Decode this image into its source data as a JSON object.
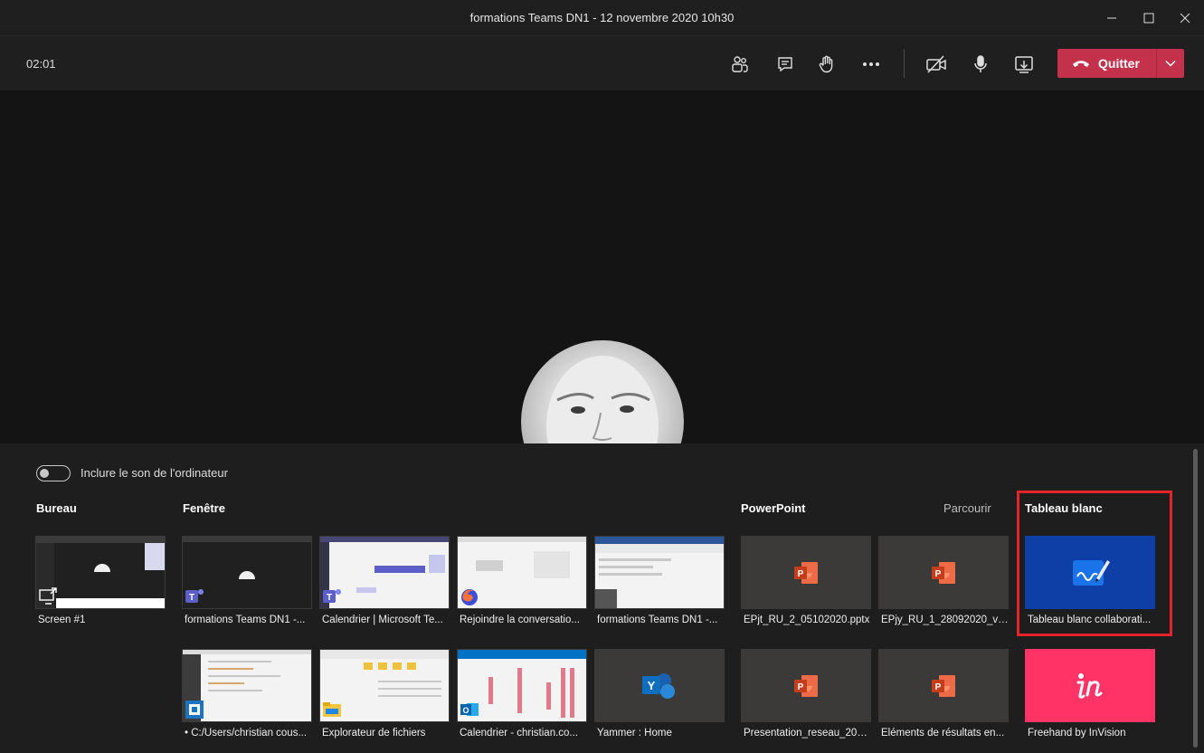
{
  "window": {
    "title": "formations Teams DN1 - 12 novembre 2020 10h30"
  },
  "toolbar": {
    "timer": "02:01",
    "leave_label": "Quitter"
  },
  "tray": {
    "include_sound_label": "Inclure le son de l'ordinateur",
    "sections": {
      "desktop": "Bureau",
      "window": "Fenêtre",
      "powerpoint": "PowerPoint",
      "browse": "Parcourir",
      "whiteboard": "Tableau blanc"
    },
    "desktop_tiles": [
      {
        "caption": "Screen #1"
      }
    ],
    "window_tiles": [
      {
        "caption": "formations Teams DN1 -..."
      },
      {
        "caption": "Calendrier | Microsoft Te..."
      },
      {
        "caption": "Rejoindre la conversatio..."
      },
      {
        "caption": "formations Teams DN1 -..."
      },
      {
        "caption": "• C:/Users/christian cous..."
      },
      {
        "caption": "Explorateur de fichiers"
      },
      {
        "caption": "Calendrier - christian.co..."
      },
      {
        "caption": "Yammer : Home"
      }
    ],
    "powerpoint_tiles": [
      {
        "caption": "EPjt_RU_2_05102020.pptx"
      },
      {
        "caption": "EPjy_RU_1_28092020_vd...."
      },
      {
        "caption": "Presentation_reseau_202..."
      },
      {
        "caption": "Eléments de résultats en..."
      }
    ],
    "whiteboard_tiles": [
      {
        "caption": "Tableau blanc collaborati..."
      },
      {
        "caption": "Freehand by InVision"
      }
    ]
  },
  "colors": {
    "leave_button": "#c4314b",
    "highlight_border": "#e3242b",
    "whiteboard_tile": "#0d3fa6",
    "invision_tile": "#ff3366"
  }
}
